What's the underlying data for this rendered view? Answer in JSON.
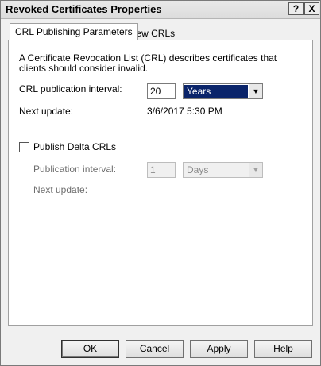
{
  "window": {
    "title": "Revoked Certificates Properties",
    "help_glyph": "?",
    "close_glyph": "X"
  },
  "tabs": [
    {
      "label": "CRL Publishing Parameters"
    },
    {
      "label": "View CRLs"
    }
  ],
  "crl": {
    "description": "A Certificate Revocation List (CRL) describes certificates that clients should consider invalid.",
    "interval_label": "CRL publication interval:",
    "interval_value": "20",
    "interval_unit": "Years",
    "next_update_label": "Next update:",
    "next_update_value": "3/6/2017 5:30 PM"
  },
  "delta": {
    "checkbox_label": "Publish Delta CRLs",
    "checked": false,
    "interval_label": "Publication interval:",
    "interval_value": "1",
    "interval_unit": "Days",
    "next_update_label": "Next update:"
  },
  "buttons": {
    "ok": "OK",
    "cancel": "Cancel",
    "apply": "Apply",
    "help": "Help"
  }
}
